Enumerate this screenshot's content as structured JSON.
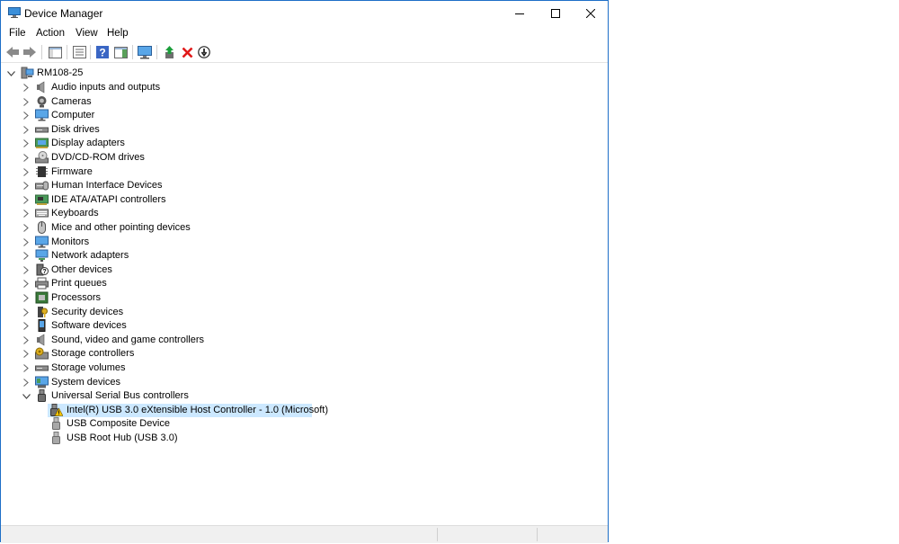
{
  "window": {
    "title": "Device Manager"
  },
  "menu": [
    "File",
    "Action",
    "View",
    "Help"
  ],
  "toolbar": {
    "buttons": [
      "back",
      "forward",
      "show-hide-console-tree",
      "properties",
      "help",
      "action-pane",
      "scan-hardware",
      "update-driver",
      "uninstall-device",
      "disable-device"
    ]
  },
  "tree": {
    "root": "RM108-25",
    "categories": [
      {
        "label": "Audio inputs and outputs",
        "icon": "speaker-icon"
      },
      {
        "label": "Cameras",
        "icon": "camera-icon"
      },
      {
        "label": "Computer",
        "icon": "computer-icon"
      },
      {
        "label": "Disk drives",
        "icon": "disk-drive-icon"
      },
      {
        "label": "Display adapters",
        "icon": "display-adapter-icon"
      },
      {
        "label": "DVD/CD-ROM drives",
        "icon": "dvd-icon"
      },
      {
        "label": "Firmware",
        "icon": "firmware-icon"
      },
      {
        "label": "Human Interface Devices",
        "icon": "hid-icon"
      },
      {
        "label": "IDE ATA/ATAPI controllers",
        "icon": "ide-controller-icon"
      },
      {
        "label": "Keyboards",
        "icon": "keyboard-icon"
      },
      {
        "label": "Mice and other pointing devices",
        "icon": "mouse-icon"
      },
      {
        "label": "Monitors",
        "icon": "monitor-icon"
      },
      {
        "label": "Network adapters",
        "icon": "network-adapter-icon"
      },
      {
        "label": "Other devices",
        "icon": "other-devices-icon"
      },
      {
        "label": "Print queues",
        "icon": "printer-icon"
      },
      {
        "label": "Processors",
        "icon": "processor-icon"
      },
      {
        "label": "Security devices",
        "icon": "security-device-icon"
      },
      {
        "label": "Software devices",
        "icon": "software-device-icon"
      },
      {
        "label": "Sound, video and game controllers",
        "icon": "sound-icon"
      },
      {
        "label": "Storage controllers",
        "icon": "storage-controller-icon"
      },
      {
        "label": "Storage volumes",
        "icon": "storage-volume-icon"
      },
      {
        "label": "System devices",
        "icon": "system-devices-icon"
      },
      {
        "label": "Universal Serial Bus controllers",
        "icon": "usb-icon",
        "expanded": true
      }
    ],
    "usb_children": [
      {
        "label": "Intel(R) USB 3.0 eXtensible Host Controller - 1.0 (Microsoft)",
        "icon": "usb-warning-icon",
        "selected": true
      },
      {
        "label": "USB Composite Device",
        "icon": "usb-plug-icon"
      },
      {
        "label": "USB Root Hub (USB 3.0)",
        "icon": "usb-plug-icon"
      }
    ]
  },
  "colors": {
    "selection": "#cce8ff",
    "border": "#1e6fc7",
    "warning": "#f5c400",
    "uninstall_red": "#e01818",
    "green": "#1a9e3a"
  }
}
